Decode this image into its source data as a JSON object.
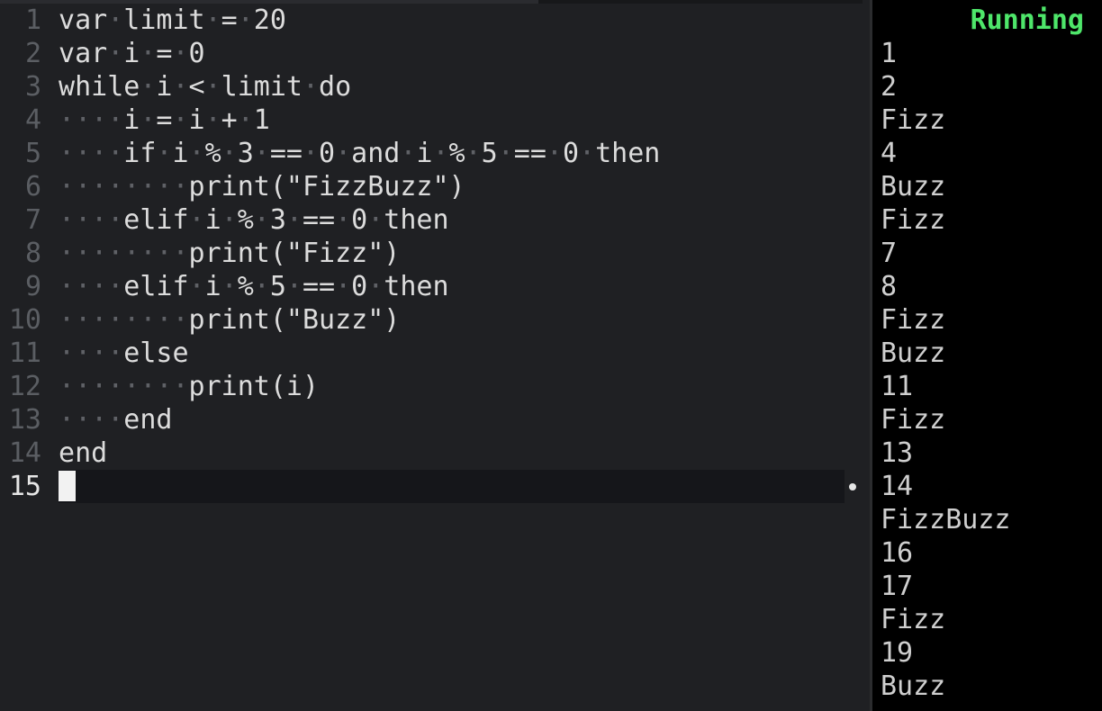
{
  "editor": {
    "lines": [
      {
        "num": "1",
        "indent": "",
        "text": "var limit = 20"
      },
      {
        "num": "2",
        "indent": "",
        "text": "var i = 0"
      },
      {
        "num": "3",
        "indent": "",
        "text": "while i < limit do"
      },
      {
        "num": "4",
        "indent": "    ",
        "text": "i = i + 1"
      },
      {
        "num": "5",
        "indent": "    ",
        "text": "if i % 3 == 0 and i % 5 == 0 then"
      },
      {
        "num": "6",
        "indent": "        ",
        "text": "print(\"FizzBuzz\")"
      },
      {
        "num": "7",
        "indent": "    ",
        "text": "elif i % 3 == 0 then"
      },
      {
        "num": "8",
        "indent": "        ",
        "text": "print(\"Fizz\")"
      },
      {
        "num": "9",
        "indent": "    ",
        "text": "elif i % 5 == 0 then"
      },
      {
        "num": "10",
        "indent": "        ",
        "text": "print(\"Buzz\")"
      },
      {
        "num": "11",
        "indent": "    ",
        "text": "else"
      },
      {
        "num": "12",
        "indent": "        ",
        "text": "print(i)"
      },
      {
        "num": "13",
        "indent": "    ",
        "text": "end"
      },
      {
        "num": "14",
        "indent": "",
        "text": "end"
      },
      {
        "num": "15",
        "indent": "",
        "text": ""
      }
    ],
    "current_line": "15"
  },
  "output": {
    "status": "Running",
    "status_color": "#4ee66a",
    "lines": [
      "1",
      "2",
      "Fizz",
      "4",
      "Buzz",
      "Fizz",
      "7",
      "8",
      "Fizz",
      "Buzz",
      "11",
      "Fizz",
      "13",
      "14",
      "FizzBuzz",
      "16",
      "17",
      "Fizz",
      "19",
      "Buzz"
    ]
  }
}
